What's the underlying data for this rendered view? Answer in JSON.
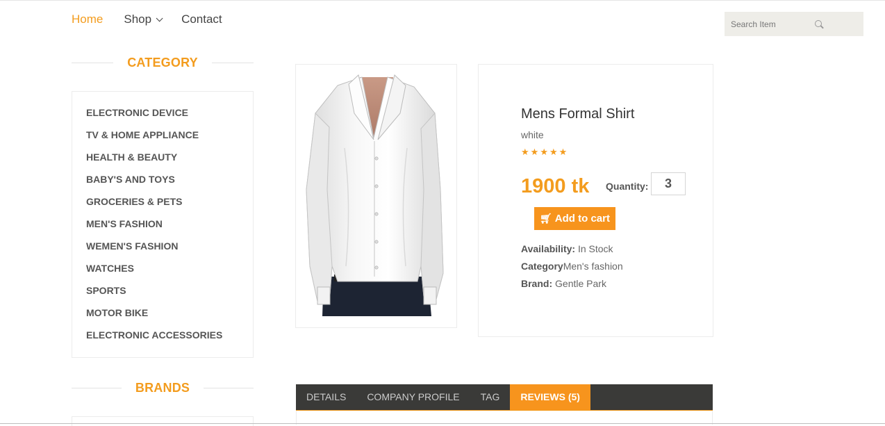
{
  "nav": {
    "items": [
      {
        "label": "Home",
        "active": true
      },
      {
        "label": "Shop",
        "has_dropdown": true
      },
      {
        "label": "Contact"
      }
    ]
  },
  "search": {
    "placeholder": "Search Item",
    "icon": "search-icon"
  },
  "sidebar": {
    "category_title": "CATEGORY",
    "categories": [
      "ELECTRONIC DEVICE",
      "TV & HOME APPLIANCE",
      "HEALTH & BEAUTY",
      "BABY'S AND TOYS",
      "GROCERIES & PETS",
      "MEN'S FASHION",
      "WEMEN'S FASHION",
      "WATCHES",
      "SPORTS",
      "MOTOR BIKE",
      "ELECTRONIC ACCESSORIES"
    ],
    "brands_title": "BRANDS"
  },
  "product": {
    "title": "Mens Formal Shirt",
    "color": "white",
    "rating": 4.5,
    "price": "1900 tk",
    "quantity_label": "Quantity:",
    "quantity": "3",
    "add_to_cart": "Add to cart",
    "availability_label": "Availability:",
    "availability": "In Stock",
    "category_label": "Category",
    "category": "Men's fashion",
    "brand_label": "Brand:",
    "brand": "Gentle Park"
  },
  "tabs": [
    {
      "label": "DETAILS"
    },
    {
      "label": "COMPANY PROFILE"
    },
    {
      "label": "TAG"
    },
    {
      "label": "REVIEWS (5)",
      "active": true
    }
  ],
  "colors": {
    "accent": "#f7941d",
    "tab_bar": "#3a3a38"
  }
}
